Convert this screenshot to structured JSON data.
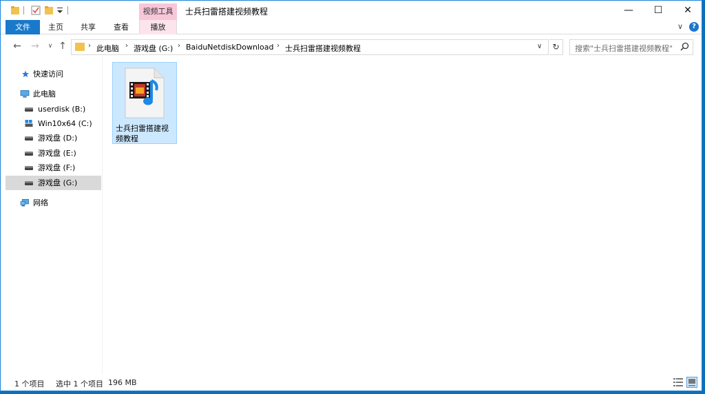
{
  "window": {
    "title": "士兵扫雷搭建视频教程",
    "context_tab_group": "视频工具",
    "controls": {
      "minimize": "—",
      "maximize": "☐",
      "close": "✕"
    }
  },
  "ribbon": {
    "tabs": [
      {
        "label": "文件"
      },
      {
        "label": "主页"
      },
      {
        "label": "共享"
      },
      {
        "label": "查看"
      },
      {
        "label": "播放"
      }
    ],
    "expand_icon": "∨",
    "help_label": "?"
  },
  "navigation": {
    "back": "←",
    "forward": "→",
    "recent": "∨",
    "up": "↑",
    "breadcrumbs": [
      "此电脑",
      "游戏盘 (G:)",
      "BaiduNetdiskDownload",
      "士兵扫雷搭建视频教程"
    ],
    "crumb_separator": "›",
    "address_dropdown": "∨",
    "refresh": "↻"
  },
  "search": {
    "placeholder": "搜索\"士兵扫雷搭建视频教程\"",
    "icon": "search-icon"
  },
  "sidebar": {
    "quick_access": "快速访问",
    "this_pc": "此电脑",
    "drives": [
      {
        "label": "userdisk (B:)"
      },
      {
        "label": "Win10x64 (C:)"
      },
      {
        "label": "游戏盘 (D:)"
      },
      {
        "label": "游戏盘 (E:)"
      },
      {
        "label": "游戏盘 (F:)"
      },
      {
        "label": "游戏盘 (G:)"
      }
    ],
    "network": "网络"
  },
  "content": {
    "files": [
      {
        "name": "士兵扫雷搭建视频教程",
        "icon": "video-file-icon"
      }
    ]
  },
  "status": {
    "item_count": "1 个项目",
    "selection": "选中 1 个项目",
    "size": "196 MB"
  },
  "colors": {
    "accent": "#1979ca",
    "selection_bg": "#cce8ff",
    "context_tab": "#f7c6d8"
  }
}
